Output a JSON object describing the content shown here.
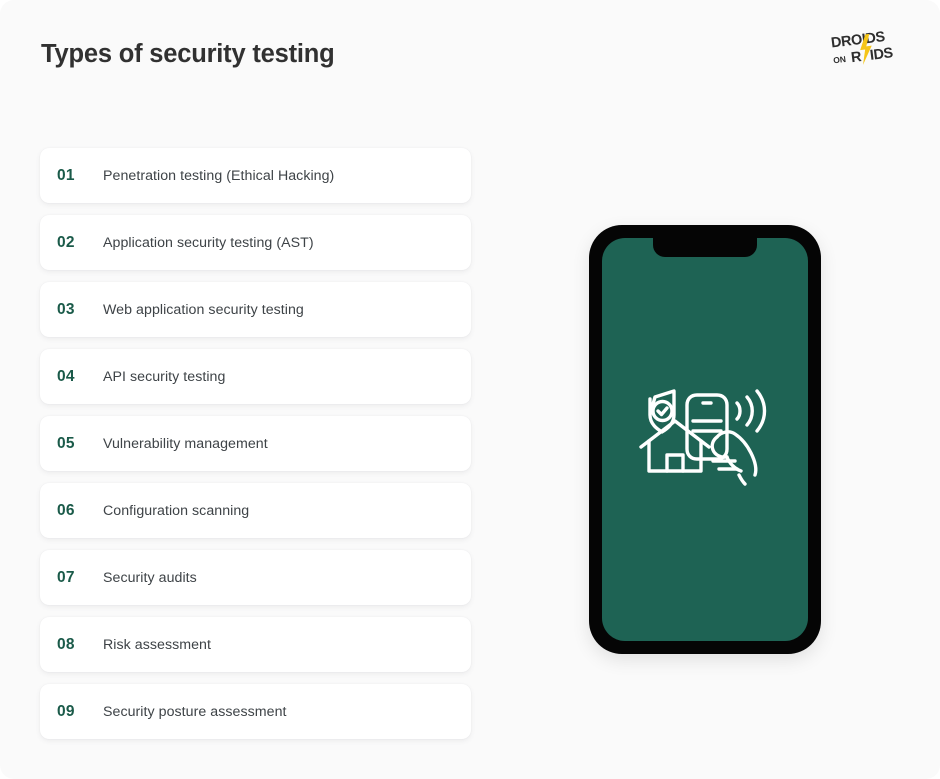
{
  "header": {
    "title": "Types of security testing",
    "logo": {
      "name": "droids-on-roids-logo",
      "line1": "DROIDS",
      "line2_small": "ON",
      "line2_left": "R",
      "line2_right": "IDS",
      "bolt_color": "#f5c518",
      "text_color": "#2e2e2e"
    }
  },
  "colors": {
    "background": "#fafafa",
    "card": "#ffffff",
    "number_green": "#1a5a49",
    "label_text": "#3e4347",
    "title_text": "#313131",
    "phone_body": "#050505",
    "phone_screen_green": "#1e6354",
    "illustration_stroke": "#ffffff"
  },
  "list": {
    "items": [
      {
        "number": "01",
        "label": "Penetration testing (Ethical Hacking)"
      },
      {
        "number": "02",
        "label": "Application security testing (AST)"
      },
      {
        "number": "03",
        "label": "Web application security testing"
      },
      {
        "number": "04",
        "label": "API security testing"
      },
      {
        "number": "05",
        "label": "Vulnerability management"
      },
      {
        "number": "06",
        "label": "Configuration scanning"
      },
      {
        "number": "07",
        "label": "Security audits"
      },
      {
        "number": "08",
        "label": "Risk assessment"
      },
      {
        "number": "09",
        "label": "Security posture assessment"
      }
    ]
  },
  "phone": {
    "name": "smartphone-mockup",
    "illustration": {
      "name": "smart-home-security-illustration",
      "elements": [
        "shield-check-icon",
        "house-icon",
        "smartphone-icon",
        "hand-icon",
        "wireless-signal-icon"
      ]
    }
  }
}
